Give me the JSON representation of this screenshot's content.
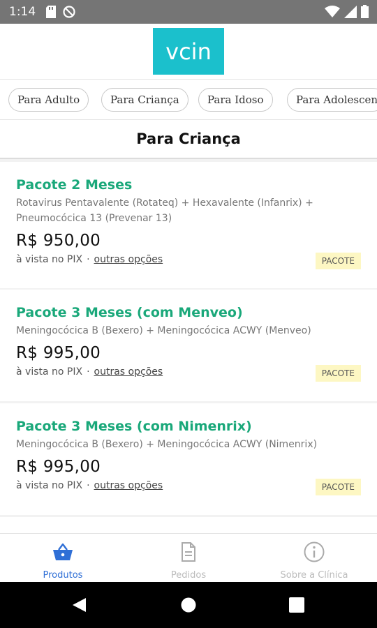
{
  "status_bar": {
    "time": "1:14",
    "icons_left": [
      "sd-card-icon",
      "no-sync-icon"
    ],
    "icons_right": [
      "wifi-icon",
      "signal-icon",
      "battery-icon"
    ]
  },
  "header": {
    "logo_text": "vcin"
  },
  "categories": [
    {
      "label": "Para Adulto",
      "selected": false
    },
    {
      "label": "Para Criança",
      "selected": true
    },
    {
      "label": "Para Idoso",
      "selected": false
    },
    {
      "label": "Para Adolescen",
      "selected": false
    }
  ],
  "section": {
    "title": "Para Criança"
  },
  "products": [
    {
      "name": "Pacote 2 Meses",
      "description": "Rotavirus Pentavalente (Rotateq) + Hexavalente (Infanrix) + Pneumocócica 13 (Prevenar 13)",
      "price": "R$ 950,00",
      "payment_note": "à vista no PIX",
      "separator": "·",
      "more_options": "outras opções",
      "badge": "PACOTE"
    },
    {
      "name": "Pacote 3 Meses (com Menveo)",
      "description": "Meningocócica B (Bexero) + Meningocócica ACWY (Menveo)",
      "price": "R$ 995,00",
      "payment_note": "à vista no PIX",
      "separator": "·",
      "more_options": "outras opções",
      "badge": "PACOTE"
    },
    {
      "name": "Pacote 3 Meses (com Nimenrix)",
      "description": "Meningocócica B (Bexero) + Meningocócica ACWY (Nimenrix)",
      "price": "R$ 995,00",
      "payment_note": "à vista no PIX",
      "separator": "·",
      "more_options": "outras opções",
      "badge": "PACOTE"
    }
  ],
  "bottom_nav": [
    {
      "label": "Produtos",
      "icon": "basket-icon",
      "active": true
    },
    {
      "label": "Pedidos",
      "icon": "document-icon",
      "active": false
    },
    {
      "label": "Sobre a Clínica",
      "icon": "info-icon",
      "active": false
    }
  ],
  "system_nav": [
    "back-icon",
    "home-icon",
    "recents-icon"
  ],
  "colors": {
    "brand": "#1bc0cc",
    "product_name": "#1aa87a",
    "active_tab": "#2f6fd6",
    "badge_bg": "#fdf7c3",
    "status_bar": "#757575"
  }
}
